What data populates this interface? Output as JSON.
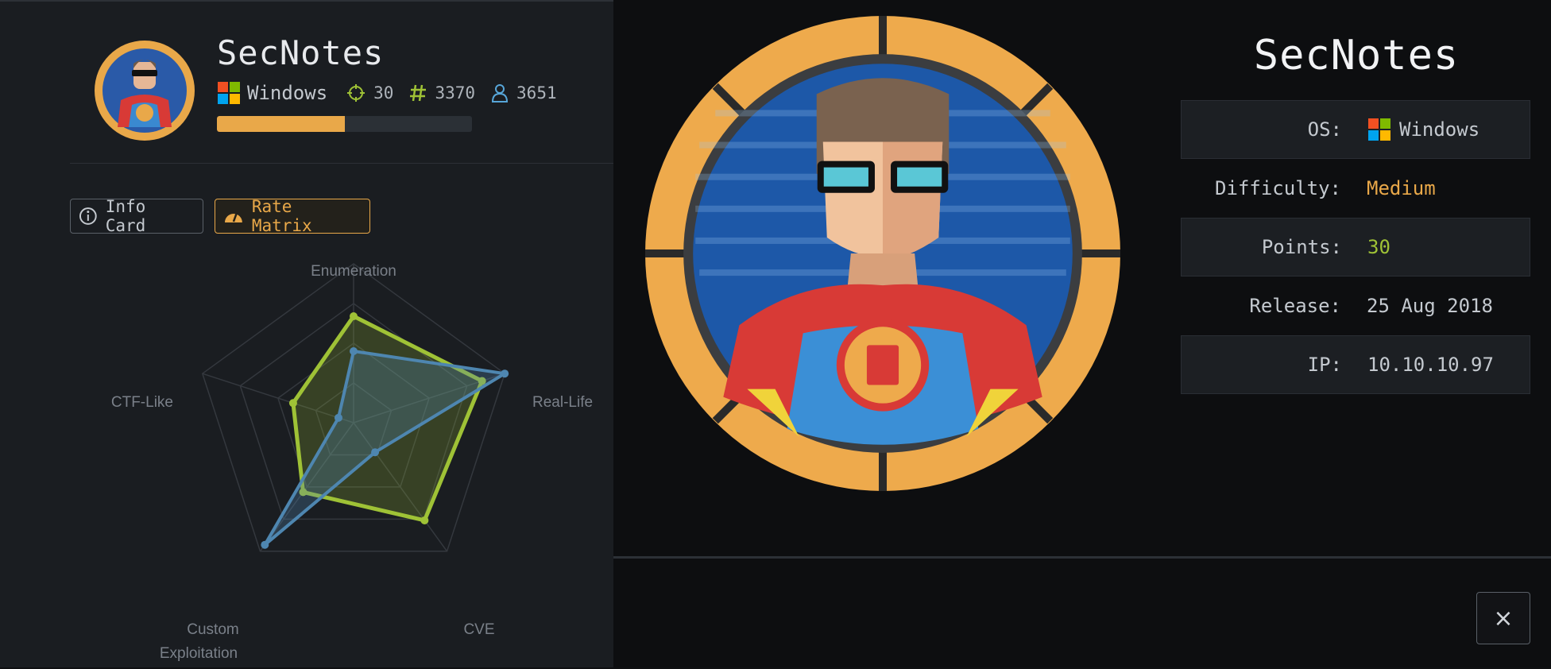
{
  "machine": {
    "name": "SecNotes",
    "os": "Windows",
    "points": "30",
    "rating_count": "3370",
    "user_owns": "3651",
    "progress": 0.5
  },
  "tabs": {
    "info_card": "Info Card",
    "rate_matrix": "Rate Matrix"
  },
  "details": {
    "title": "SecNotes",
    "rows": [
      {
        "label": "OS:",
        "value": "Windows"
      },
      {
        "label": "Difficulty:",
        "value": "Medium",
        "color": "#e9a849"
      },
      {
        "label": "Points:",
        "value": "30",
        "color": "#9fc236"
      },
      {
        "label": "Release:",
        "value": "25 Aug 2018"
      },
      {
        "label": "IP:",
        "value": "10.10.10.97"
      }
    ]
  },
  "chart_data": {
    "type": "radar",
    "axes": [
      "Enumeration",
      "Real-Life",
      "CVE",
      "Custom Exploitation",
      "CTF-Like"
    ],
    "series": [
      {
        "values": [
          6.7,
          8.5,
          7.6,
          5.4,
          4.0
        ],
        "color": "#9fc236"
      },
      {
        "values": [
          4.5,
          10.0,
          2.3,
          9.5,
          1.0
        ],
        "color": "#4e86b0"
      }
    ],
    "max": 10
  },
  "close_label": "×"
}
